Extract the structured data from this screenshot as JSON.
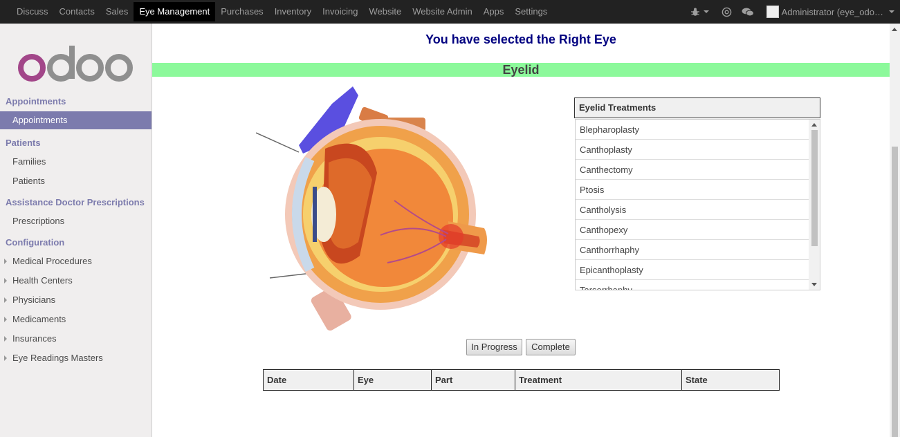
{
  "topnav": {
    "items": [
      "Discuss",
      "Contacts",
      "Sales",
      "Eye Management",
      "Purchases",
      "Inventory",
      "Invoicing",
      "Website",
      "Website Admin",
      "Apps",
      "Settings"
    ],
    "active": "Eye Management"
  },
  "topbar_right": {
    "debug_icon": "bug-icon",
    "mention_icon": "at-icon",
    "chat_icon": "chat-bubbles-icon",
    "user_label": "Administrator (eye_odo…"
  },
  "sidebar": {
    "logo_text": "odoo",
    "sections": [
      {
        "title": "Appointments",
        "items": [
          {
            "label": "Appointments",
            "active": true
          }
        ]
      },
      {
        "title": "Patients",
        "items": [
          {
            "label": "Families"
          },
          {
            "label": "Patients"
          }
        ]
      },
      {
        "title": "Assistance Doctor Prescriptions",
        "items": [
          {
            "label": "Prescriptions"
          }
        ]
      },
      {
        "title": "Configuration",
        "items": [
          {
            "label": "Medical Procedures"
          },
          {
            "label": "Health Centers"
          },
          {
            "label": "Physicians"
          },
          {
            "label": "Medicaments"
          },
          {
            "label": "Insurances"
          },
          {
            "label": "Eye Readings Masters"
          }
        ]
      }
    ]
  },
  "main": {
    "selected_title": "You have selected the Right Eye",
    "part_title": "Eyelid",
    "treatments": {
      "header": "Eyelid Treatments",
      "items": [
        "Blepharoplasty",
        "Canthoplasty",
        "Canthectomy",
        "Ptosis",
        "Cantholysis",
        "Canthopexy",
        "Canthorrhaphy",
        "Epicanthoplasty",
        "Tarsorrhaphy"
      ]
    },
    "buttons": {
      "in_progress": "In Progress",
      "complete": "Complete"
    },
    "table": {
      "headers": [
        "Date",
        "Eye",
        "Part",
        "Treatment",
        "State"
      ]
    }
  }
}
